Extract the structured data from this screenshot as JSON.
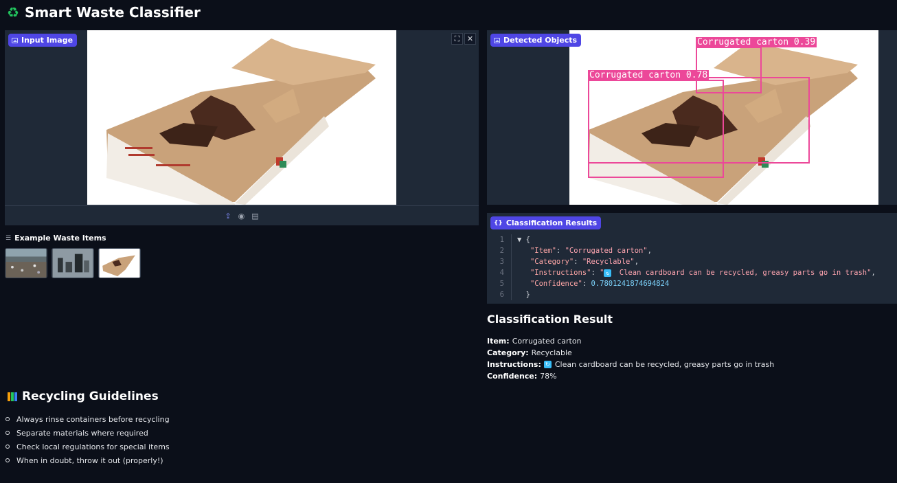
{
  "app": {
    "title": "Smart Waste Classifier",
    "title_icon": "recycle-icon"
  },
  "input_panel": {
    "label": "Input Image",
    "controls": [
      "fullscreen-icon",
      "close-icon"
    ],
    "toolbar": [
      "upload-icon",
      "webcam-icon",
      "clipboard-icon"
    ]
  },
  "examples": {
    "label": "Example Waste Items",
    "items": [
      "beach-litter-example",
      "cans-bottles-example",
      "pizza-box-example"
    ]
  },
  "guidelines": {
    "title": "Recycling Guidelines",
    "items": [
      "Always rinse containers before recycling",
      "Separate materials where required",
      "Check local regulations for special items",
      "When in doubt, throw it out (properly!)"
    ]
  },
  "detected_panel": {
    "label": "Detected Objects",
    "detections": [
      {
        "label": "Corrugated carton 0.39"
      },
      {
        "label": "Corrugated carton 0.78"
      }
    ]
  },
  "classification_panel": {
    "label": "Classification Results",
    "lines": {
      "n1": "1",
      "n2": "2",
      "n3": "3",
      "n4": "4",
      "n5": "5",
      "n6": "6",
      "open": "{",
      "k_item": "\"Item\"",
      "v_item": "\"Corrugated carton\"",
      "k_cat": "\"Category\"",
      "v_cat": "\"Recyclable\"",
      "k_ins": "\"Instructions\"",
      "v_ins_pre": "\"",
      "v_ins": " Clean cardboard can be recycled, greasy parts go in trash\"",
      "k_conf": "\"Confidence\"",
      "v_conf": "0.7801241874694824",
      "close": "}"
    }
  },
  "result": {
    "title": "Classification Result",
    "item_label": "Item:",
    "item_value": "Corrugated carton",
    "category_label": "Category:",
    "category_value": "Recyclable",
    "instructions_label": "Instructions:",
    "instructions_value": "Clean cardboard can be recycled, greasy parts go in trash",
    "confidence_label": "Confidence:",
    "confidence_value": "78%"
  },
  "colors": {
    "accent": "#4f46e5",
    "detection": "#ec4899",
    "background": "#0b0f19",
    "panel": "#1f2937"
  }
}
